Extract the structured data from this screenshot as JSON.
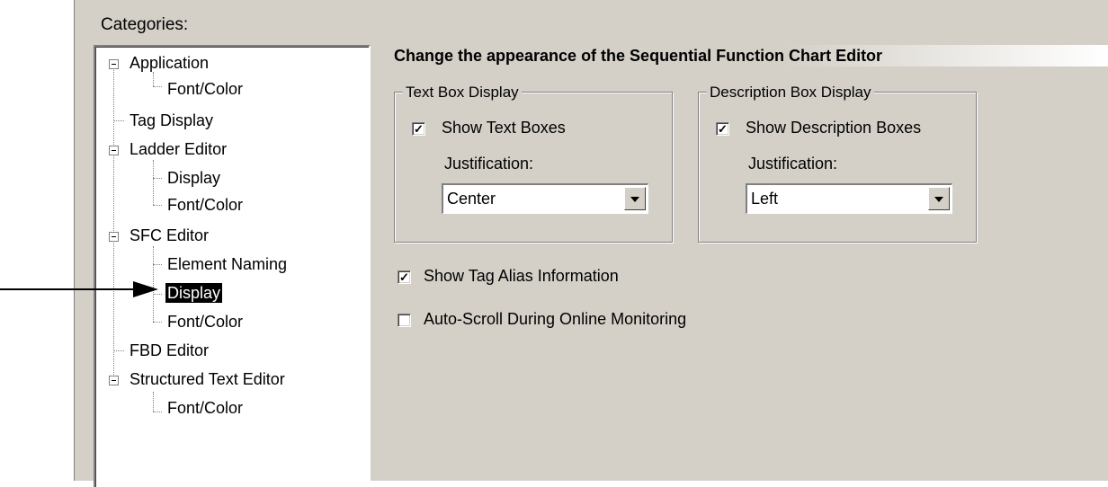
{
  "categories_label": "Categories:",
  "tree": {
    "application": "Application",
    "application_font_color": "Font/Color",
    "tag_display": "Tag Display",
    "ladder_editor": "Ladder Editor",
    "ladder_display": "Display",
    "ladder_font_color": "Font/Color",
    "sfc_editor": "SFC Editor",
    "sfc_element_naming": "Element Naming",
    "sfc_display": "Display",
    "sfc_font_color": "Font/Color",
    "fbd_editor": "FBD Editor",
    "structured_text_editor": "Structured Text Editor",
    "st_font_color": "Font/Color",
    "selected": "sfc_display"
  },
  "banner_title": "Change the appearance of the Sequential Function Chart Editor",
  "text_box_display": {
    "title": "Text Box Display",
    "show_label": "Show Text Boxes",
    "show_checked": true,
    "justification_label": "Justification:",
    "justification_value": "Center"
  },
  "description_box_display": {
    "title": "Description Box Display",
    "show_label": "Show Description Boxes",
    "show_checked": true,
    "justification_label": "Justification:",
    "justification_value": "Left"
  },
  "show_tag_alias": {
    "label": "Show Tag Alias Information",
    "checked": true
  },
  "auto_scroll": {
    "label": "Auto-Scroll During Online Monitoring",
    "checked": false
  }
}
